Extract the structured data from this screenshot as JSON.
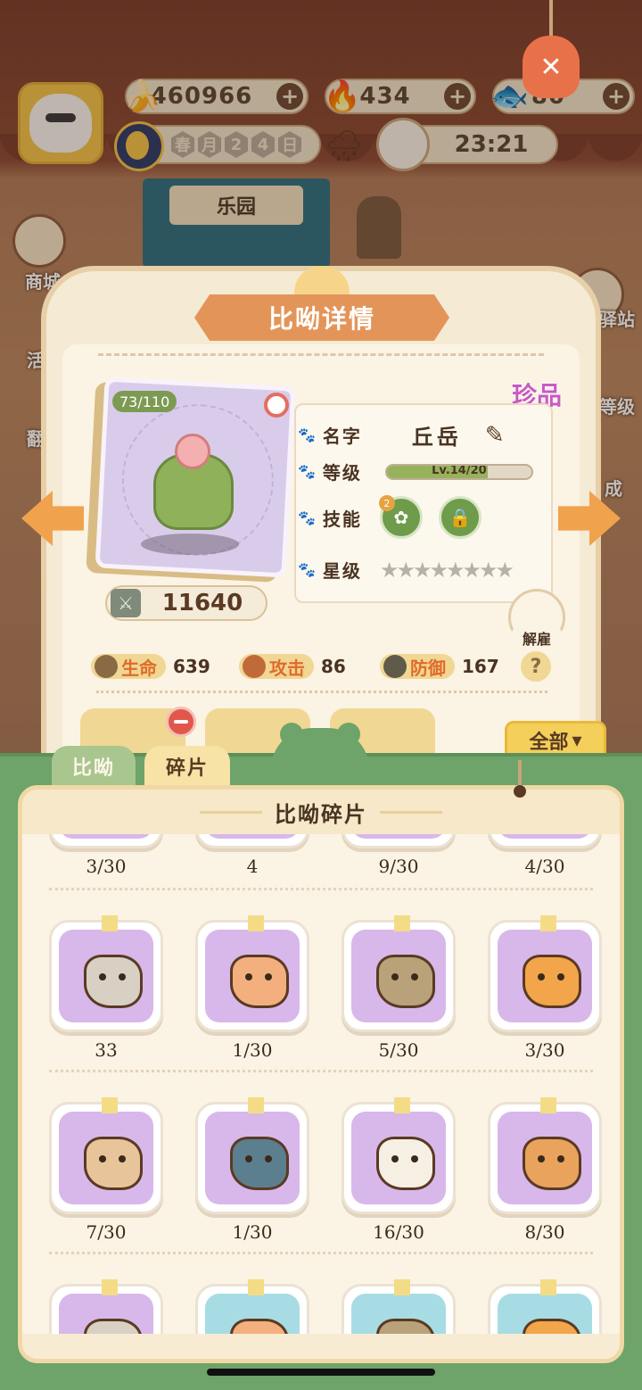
{
  "top_bar": {
    "currency_banana": "460966",
    "currency_fire": "434",
    "currency_fish": "80",
    "date_chars": [
      "春",
      "月",
      "2",
      "4",
      "日"
    ],
    "time": "23:21",
    "icons": {
      "banana": "banana-icon",
      "fire": "fire-icon",
      "fish": "fish-icon",
      "weather": "rain-cloud-icon"
    }
  },
  "background": {
    "stall_sign": "乐园",
    "side_left": [
      "商城",
      "活",
      "翻"
    ],
    "side_right": [
      "驿站",
      "等级",
      "成"
    ]
  },
  "detail": {
    "title": "比呦详情",
    "rarity": "珍品",
    "card_progress": "73/110",
    "power": "11640",
    "name_label": "名字",
    "name_value": "丘岳",
    "level_label": "等级",
    "level_value": "Lv.14/20",
    "level_fraction": 0.7,
    "skill_label": "技能",
    "skill_badge": "2",
    "star_label": "星级",
    "stars_filled": 0,
    "stars_total": 8,
    "dismiss_label": "解雇",
    "stats": {
      "hp_label": "生命",
      "hp_value": "639",
      "atk_label": "攻击",
      "atk_value": "86",
      "def_label": "防御",
      "def_value": "167"
    },
    "help_label": "?"
  },
  "sheet": {
    "filter_label": "全部",
    "tab_pets": "比呦",
    "tab_fragments": "碎片",
    "header": "比呦碎片",
    "rows": [
      [
        {
          "count": "3/30",
          "color": "#d8b8ea"
        },
        {
          "count": "4",
          "color": "#d8b8ea"
        },
        {
          "count": "9/30",
          "color": "#d8b8ea"
        },
        {
          "count": "4/30",
          "color": "#d8b8ea"
        }
      ],
      [
        {
          "count": "33",
          "color": "#d8b8ea"
        },
        {
          "count": "1/30",
          "color": "#d8b8ea"
        },
        {
          "count": "5/30",
          "color": "#d8b8ea"
        },
        {
          "count": "3/30",
          "color": "#d8b8ea"
        }
      ],
      [
        {
          "count": "7/30",
          "color": "#d8b8ea"
        },
        {
          "count": "1/30",
          "color": "#d8b8ea"
        },
        {
          "count": "16/30",
          "color": "#d8b8ea"
        },
        {
          "count": "8/30",
          "color": "#d8b8ea"
        }
      ],
      [
        {
          "count": "",
          "color": "#d8b8ea"
        },
        {
          "count": "",
          "color": "#a8dce4"
        },
        {
          "count": "",
          "color": "#a8dce4"
        },
        {
          "count": "",
          "color": "#a8dce4"
        }
      ]
    ]
  },
  "colors": {
    "fragment_colors": [
      "#e8c49a",
      "#5c7f8f",
      "#f6f0e4",
      "#e9a35c",
      "#d9d0c4",
      "#f3b07e",
      "#b9a27a",
      "#f2a54a"
    ]
  }
}
